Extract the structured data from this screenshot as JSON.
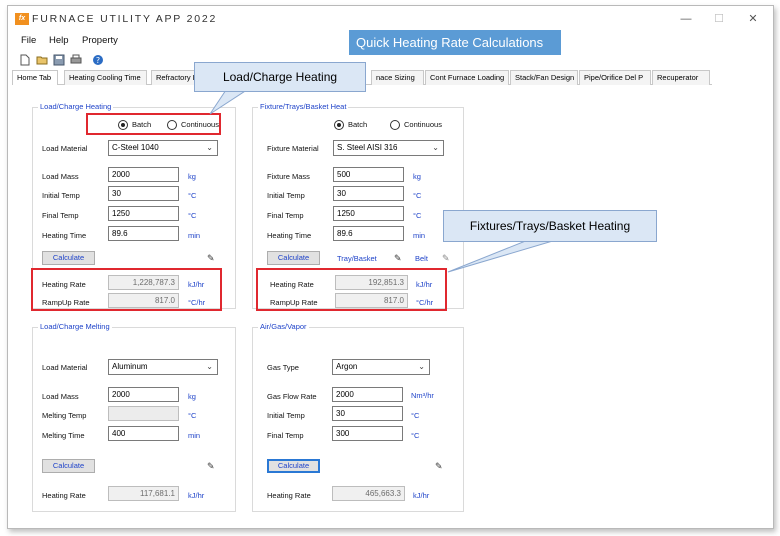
{
  "app": {
    "logo": "fx",
    "title": "FURNACE UTILITY APP 2022",
    "window_controls": {
      "minimize": "—",
      "maximize": "☐",
      "close": "✕"
    }
  },
  "menu": {
    "file": "File",
    "help": "Help",
    "property": "Property"
  },
  "toolbar": {
    "icons": [
      "new-file-icon",
      "open-folder-icon",
      "save-icon",
      "print-icon",
      "help-icon"
    ]
  },
  "banner": "Quick Heating Rate Calculations",
  "tabs": [
    {
      "label": "Home Tab"
    },
    {
      "label": "Heating Cooling Time"
    },
    {
      "label": "Refractory I"
    },
    {
      "label": "nace Sizing"
    },
    {
      "label": "Cont Furnace Loading"
    },
    {
      "label": "Stack/Fan Design"
    },
    {
      "label": "Pipe/Orifice Del P"
    },
    {
      "label": "Recuperator"
    }
  ],
  "load_heating": {
    "title": "Load/Charge Heating",
    "mode_batch": "Batch",
    "mode_continuous": "Continuous",
    "selected_mode": "Batch",
    "material_label": "Load Material",
    "material_value": "C-Steel 1040",
    "mass_label": "Load Mass",
    "mass_value": "2000",
    "mass_unit": "kg",
    "initial_label": "Initial Temp",
    "initial_value": "30",
    "initial_unit": "°C",
    "final_label": "Final Temp",
    "final_value": "1250",
    "final_unit": "°C",
    "time_label": "Heating Time",
    "time_value": "89.6",
    "time_unit": "min",
    "calculate": "Calculate",
    "rate_label": "Heating Rate",
    "rate_value": "1,228,787.3",
    "rate_unit": "kJ/hr",
    "rampup_label": "RampUp Rate",
    "rampup_value": "817.0",
    "rampup_unit": "°C/hr"
  },
  "fixture_heating": {
    "title": "Fixture/Trays/Basket Heat",
    "mode_batch": "Batch",
    "mode_continuous": "Continuous",
    "selected_mode": "Batch",
    "material_label": "Fixture Material",
    "material_value": "S. Steel AISI 316",
    "mass_label": "Fixture Mass",
    "mass_value": "500",
    "mass_unit": "kg",
    "initial_label": "Initial Temp",
    "initial_value": "30",
    "initial_unit": "°C",
    "final_label": "Final Temp",
    "final_value": "1250",
    "final_unit": "°C",
    "time_label": "Heating Time",
    "time_value": "89.6",
    "time_unit": "min",
    "calculate": "Calculate",
    "tray_basket": "Tray/Basket",
    "belt": "Belt",
    "rate_label": "Heating Rate",
    "rate_value": "192,851.3",
    "rate_unit": "kJ/hr",
    "rampup_label": "RampUp Rate",
    "rampup_value": "817.0",
    "rampup_unit": "°C/hr"
  },
  "load_melting": {
    "title": "Load/Charge Melting",
    "material_label": "Load Material",
    "material_value": "Aluminum",
    "mass_label": "Load Mass",
    "mass_value": "2000",
    "mass_unit": "kg",
    "melt_temp_label": "Melting Temp",
    "melt_temp_value": "",
    "melt_temp_unit": "°C",
    "melt_time_label": "Melting Time",
    "melt_time_value": "400",
    "melt_time_unit": "min",
    "calculate": "Calculate",
    "rate_label": "Heating Rate",
    "rate_value": "117,681.1",
    "rate_unit": "kJ/hr"
  },
  "gas_heating": {
    "title": "Air/Gas/Vapor",
    "gas_type_label": "Gas Type",
    "gas_type_value": "Argon",
    "flow_label": "Gas Flow Rate",
    "flow_value": "2000",
    "flow_unit": "Nm³/hr",
    "initial_label": "Initial Temp",
    "initial_value": "30",
    "initial_unit": "°C",
    "final_label": "Final Temp",
    "final_value": "300",
    "final_unit": "°C",
    "calculate": "Calculate",
    "rate_label": "Heating Rate",
    "rate_value": "465,663.3",
    "rate_unit": "kJ/hr"
  },
  "callouts": {
    "load": "Load/Charge Heating",
    "fixture": "Fixtures/Trays/Basket Heating"
  },
  "colors": {
    "accent": "#1f43c9",
    "banner": "#5b9bd5",
    "highlight": "#e0282f",
    "callout": "#dbe7f5"
  }
}
